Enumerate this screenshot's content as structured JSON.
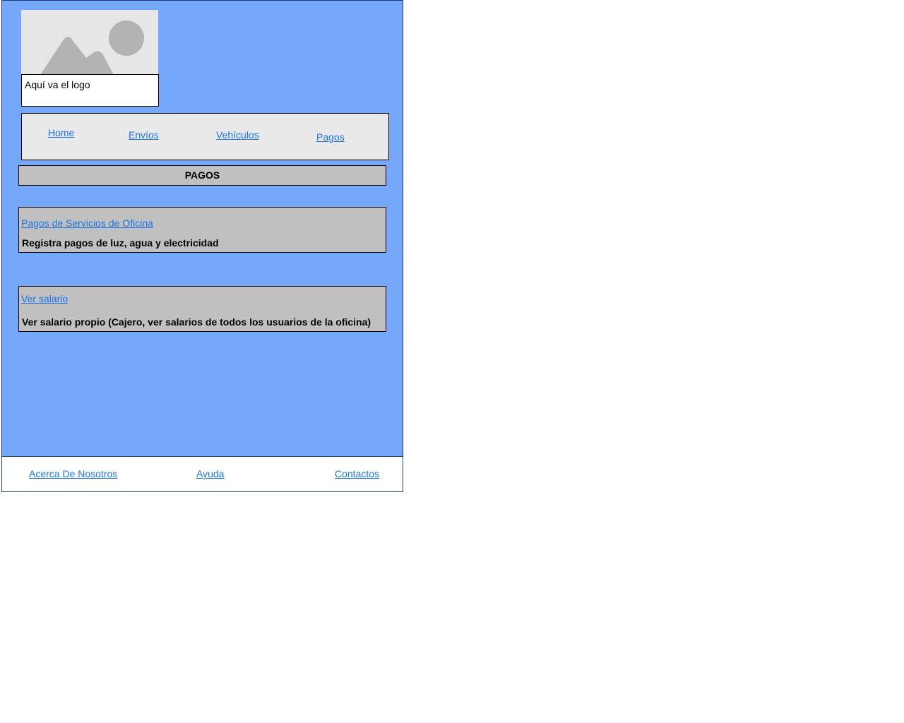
{
  "logo": {
    "image_icon": "image-placeholder-icon",
    "caption": "Aquí va el logo"
  },
  "nav": {
    "items": [
      {
        "label": "Home"
      },
      {
        "label": "Envíos"
      },
      {
        "label": "Vehículos"
      },
      {
        "label": "Pagos"
      }
    ]
  },
  "section": {
    "title": "PAGOS"
  },
  "cards": [
    {
      "link": "Pagos de Servicios de Oficina",
      "description": "Registra pagos de luz, agua y electricidad"
    },
    {
      "link": "Ver salario",
      "description": "Ver salario propio (Cajero, ver salarios de todos los usuarios de la oficina)"
    }
  ],
  "footer": {
    "links": [
      {
        "label": "Acerca De Nosotros"
      },
      {
        "label": "Ayuda"
      },
      {
        "label": "Contactos"
      }
    ]
  },
  "colors": {
    "background": "#75a8fb",
    "panel": "#c0c0c0",
    "nav_panel": "#e9e9e9",
    "link": "#1a73e8",
    "border": "#1f3b73"
  }
}
